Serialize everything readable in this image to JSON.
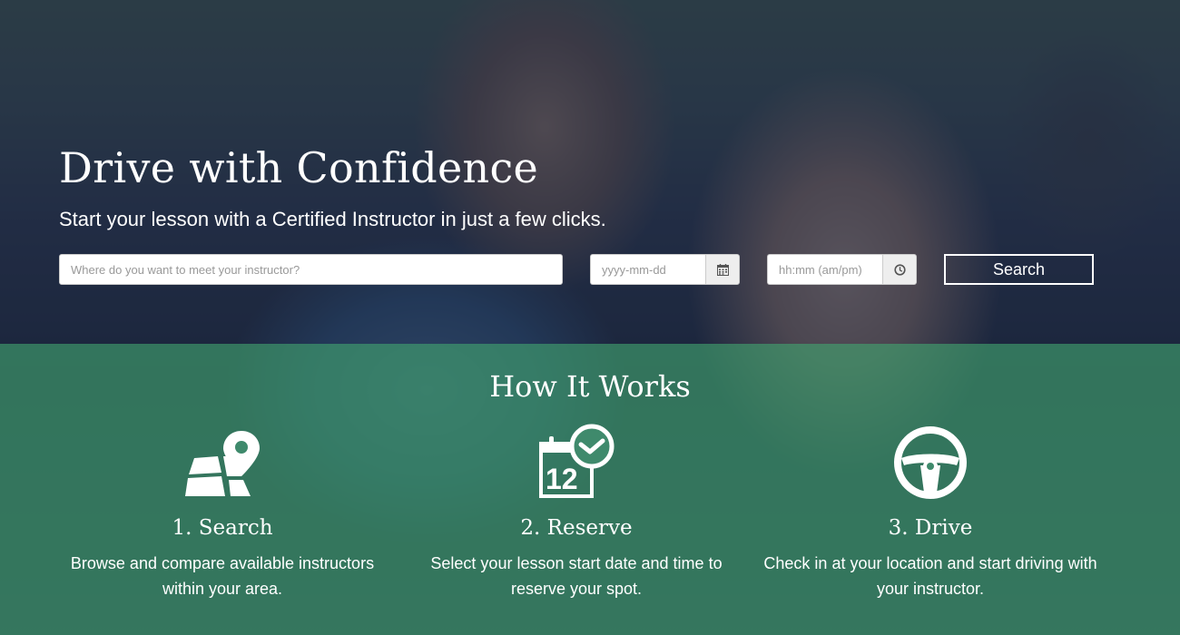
{
  "hero": {
    "title": "Drive with Confidence",
    "subtitle": "Start your lesson with a Certified Instructor in just a few clicks.",
    "location_placeholder": "Where do you want to meet your instructor?",
    "date_placeholder": "yyyy-mm-dd",
    "date_icon": "calendar-icon",
    "time_placeholder": "hh:mm (am/pm)",
    "time_icon": "clock-icon",
    "search_label": "Search"
  },
  "how_it_works": {
    "title": "How It Works",
    "steps": [
      {
        "icon": "map-pin-icon",
        "title": "1. Search",
        "description": "Browse and compare available instructors within your area."
      },
      {
        "icon": "calendar-clock-icon",
        "title": "2. Reserve",
        "description": "Select your lesson start date and time to reserve your spot.",
        "calendar_number": "12"
      },
      {
        "icon": "steering-wheel-icon",
        "title": "3. Drive",
        "description": "Check in at your location and start driving with your instructor."
      }
    ]
  },
  "colors": {
    "hero_overlay": "#12203e",
    "how_overlay": "#348062",
    "text": "#ffffff"
  }
}
